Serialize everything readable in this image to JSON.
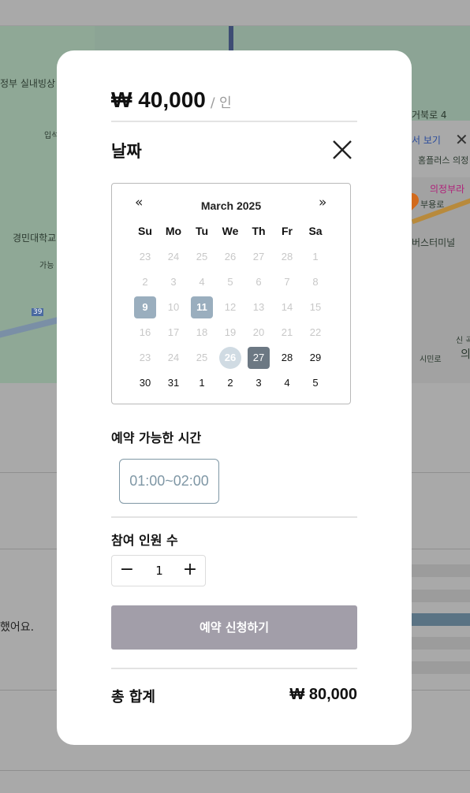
{
  "background": {
    "map_labels": {
      "lbl1": "정부 실내빙상",
      "lbl2": "경민대학교",
      "lbl3": "가능",
      "lbl4": "입석",
      "lbl5": "39",
      "lbl6": "거북로 4",
      "lbl7": "서 보기",
      "lbl8": "홈플러스 의정",
      "lbl9": "의정부라",
      "lbl10": "부용로",
      "lbl11": "버스터미널",
      "lbl12": "시민로",
      "lbl13": "신 곡",
      "lbl14": "의"
    },
    "partial_text": "했어요."
  },
  "modal": {
    "price": "₩ 40,000",
    "price_unit": "/ 인",
    "date_title": "날짜",
    "calendar": {
      "prev": "«",
      "next": "»",
      "month": "March 2025",
      "weekdays": [
        "Su",
        "Mo",
        "Tu",
        "We",
        "Th",
        "Fr",
        "Sa"
      ],
      "weeks": [
        [
          "23",
          "24",
          "25",
          "26",
          "27",
          "28",
          "1"
        ],
        [
          "2",
          "3",
          "4",
          "5",
          "6",
          "7",
          "8"
        ],
        [
          "9",
          "10",
          "11",
          "12",
          "13",
          "14",
          "15"
        ],
        [
          "16",
          "17",
          "18",
          "19",
          "20",
          "21",
          "22"
        ],
        [
          "23",
          "24",
          "25",
          "26",
          "27",
          "28",
          "29"
        ],
        [
          "30",
          "31",
          "1",
          "2",
          "3",
          "4",
          "5"
        ]
      ]
    },
    "time_title": "예약 가능한 시간",
    "time_slot": "01:00~02:00",
    "guests_title": "참여 인원 수",
    "guests_count": "1",
    "minus": "−",
    "plus": "+",
    "reserve_label": "예약 신청하기",
    "total_label": "총 합계",
    "total_value": "₩ 80,000"
  },
  "colors": {
    "available_day": "#9aaebe",
    "selected_day": "#6c7883",
    "today_day": "#d0dbe3",
    "time_slot_accent": "#7f97a5",
    "reserve_button": "#a29ea9"
  }
}
